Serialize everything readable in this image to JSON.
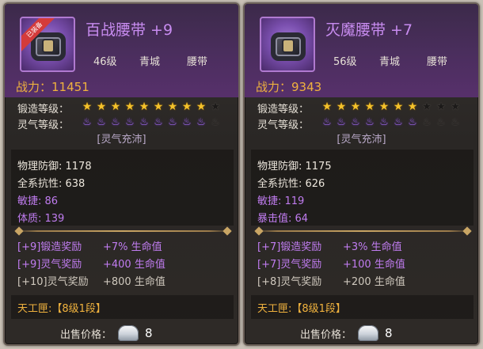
{
  "cards": [
    {
      "name": "百战腰带 +9",
      "ribbon": "已装备",
      "level": "46级",
      "school": "青城",
      "slot": "腰带",
      "power_label": "战力：",
      "power_value": "11451",
      "forge_label": "锻造等级：",
      "forge_stars": 9,
      "aura_label": "灵气等级：",
      "aura_flames": 9,
      "aura_tag": "[灵气充沛]",
      "stats": [
        {
          "text": "物理防御: 1178",
          "style": "white"
        },
        {
          "text": "全系抗性: 638",
          "style": "white"
        },
        {
          "text": "敏捷: 86",
          "style": "purple"
        },
        {
          "text": "体质: 139",
          "style": "purple"
        }
      ],
      "bonuses": [
        {
          "tag": "[+9]锻造奖励",
          "val": "+7% 生命值",
          "style": "purple"
        },
        {
          "tag": "[+9]灵气奖励",
          "val": "+400 生命值",
          "style": "purple"
        },
        {
          "tag": "[+10]灵气奖励",
          "val": "+800 生命值",
          "style": "grey"
        }
      ],
      "crafter": "天工匣:【8级1段】",
      "price_label": "出售价格：",
      "price_count": "8"
    },
    {
      "name": "灭魔腰带 +7",
      "ribbon": "",
      "level": "56级",
      "school": "青城",
      "slot": "腰带",
      "power_label": "战力：",
      "power_value": "9343",
      "forge_label": "锻造等级：",
      "forge_stars": 7,
      "aura_label": "灵气等级：",
      "aura_flames": 7,
      "aura_tag": "[灵气充沛]",
      "stats": [
        {
          "text": "物理防御: 1175",
          "style": "white"
        },
        {
          "text": "全系抗性: 626",
          "style": "white"
        },
        {
          "text": "敏捷: 119",
          "style": "purple"
        },
        {
          "text": "暴击值: 64",
          "style": "purple"
        }
      ],
      "bonuses": [
        {
          "tag": "[+7]锻造奖励",
          "val": "+3% 生命值",
          "style": "purple"
        },
        {
          "tag": "[+7]灵气奖励",
          "val": "+100 生命值",
          "style": "purple"
        },
        {
          "tag": "[+8]灵气奖励",
          "val": "+200 生命值",
          "style": "grey"
        }
      ],
      "crafter": "天工匣:【8级1段】",
      "price_label": "出售价格：",
      "price_count": "8"
    }
  ],
  "max_stars": 10,
  "icons": {
    "star": "star-icon",
    "aura": "flame-icon",
    "currency": "silver-ingot-icon"
  },
  "colors": {
    "item_name": "#c88cf0",
    "power": "#f0b23e",
    "star_on": "#f3c12b",
    "flame_on": "#a26bf2",
    "bonus_purple": "#c07cf0"
  }
}
